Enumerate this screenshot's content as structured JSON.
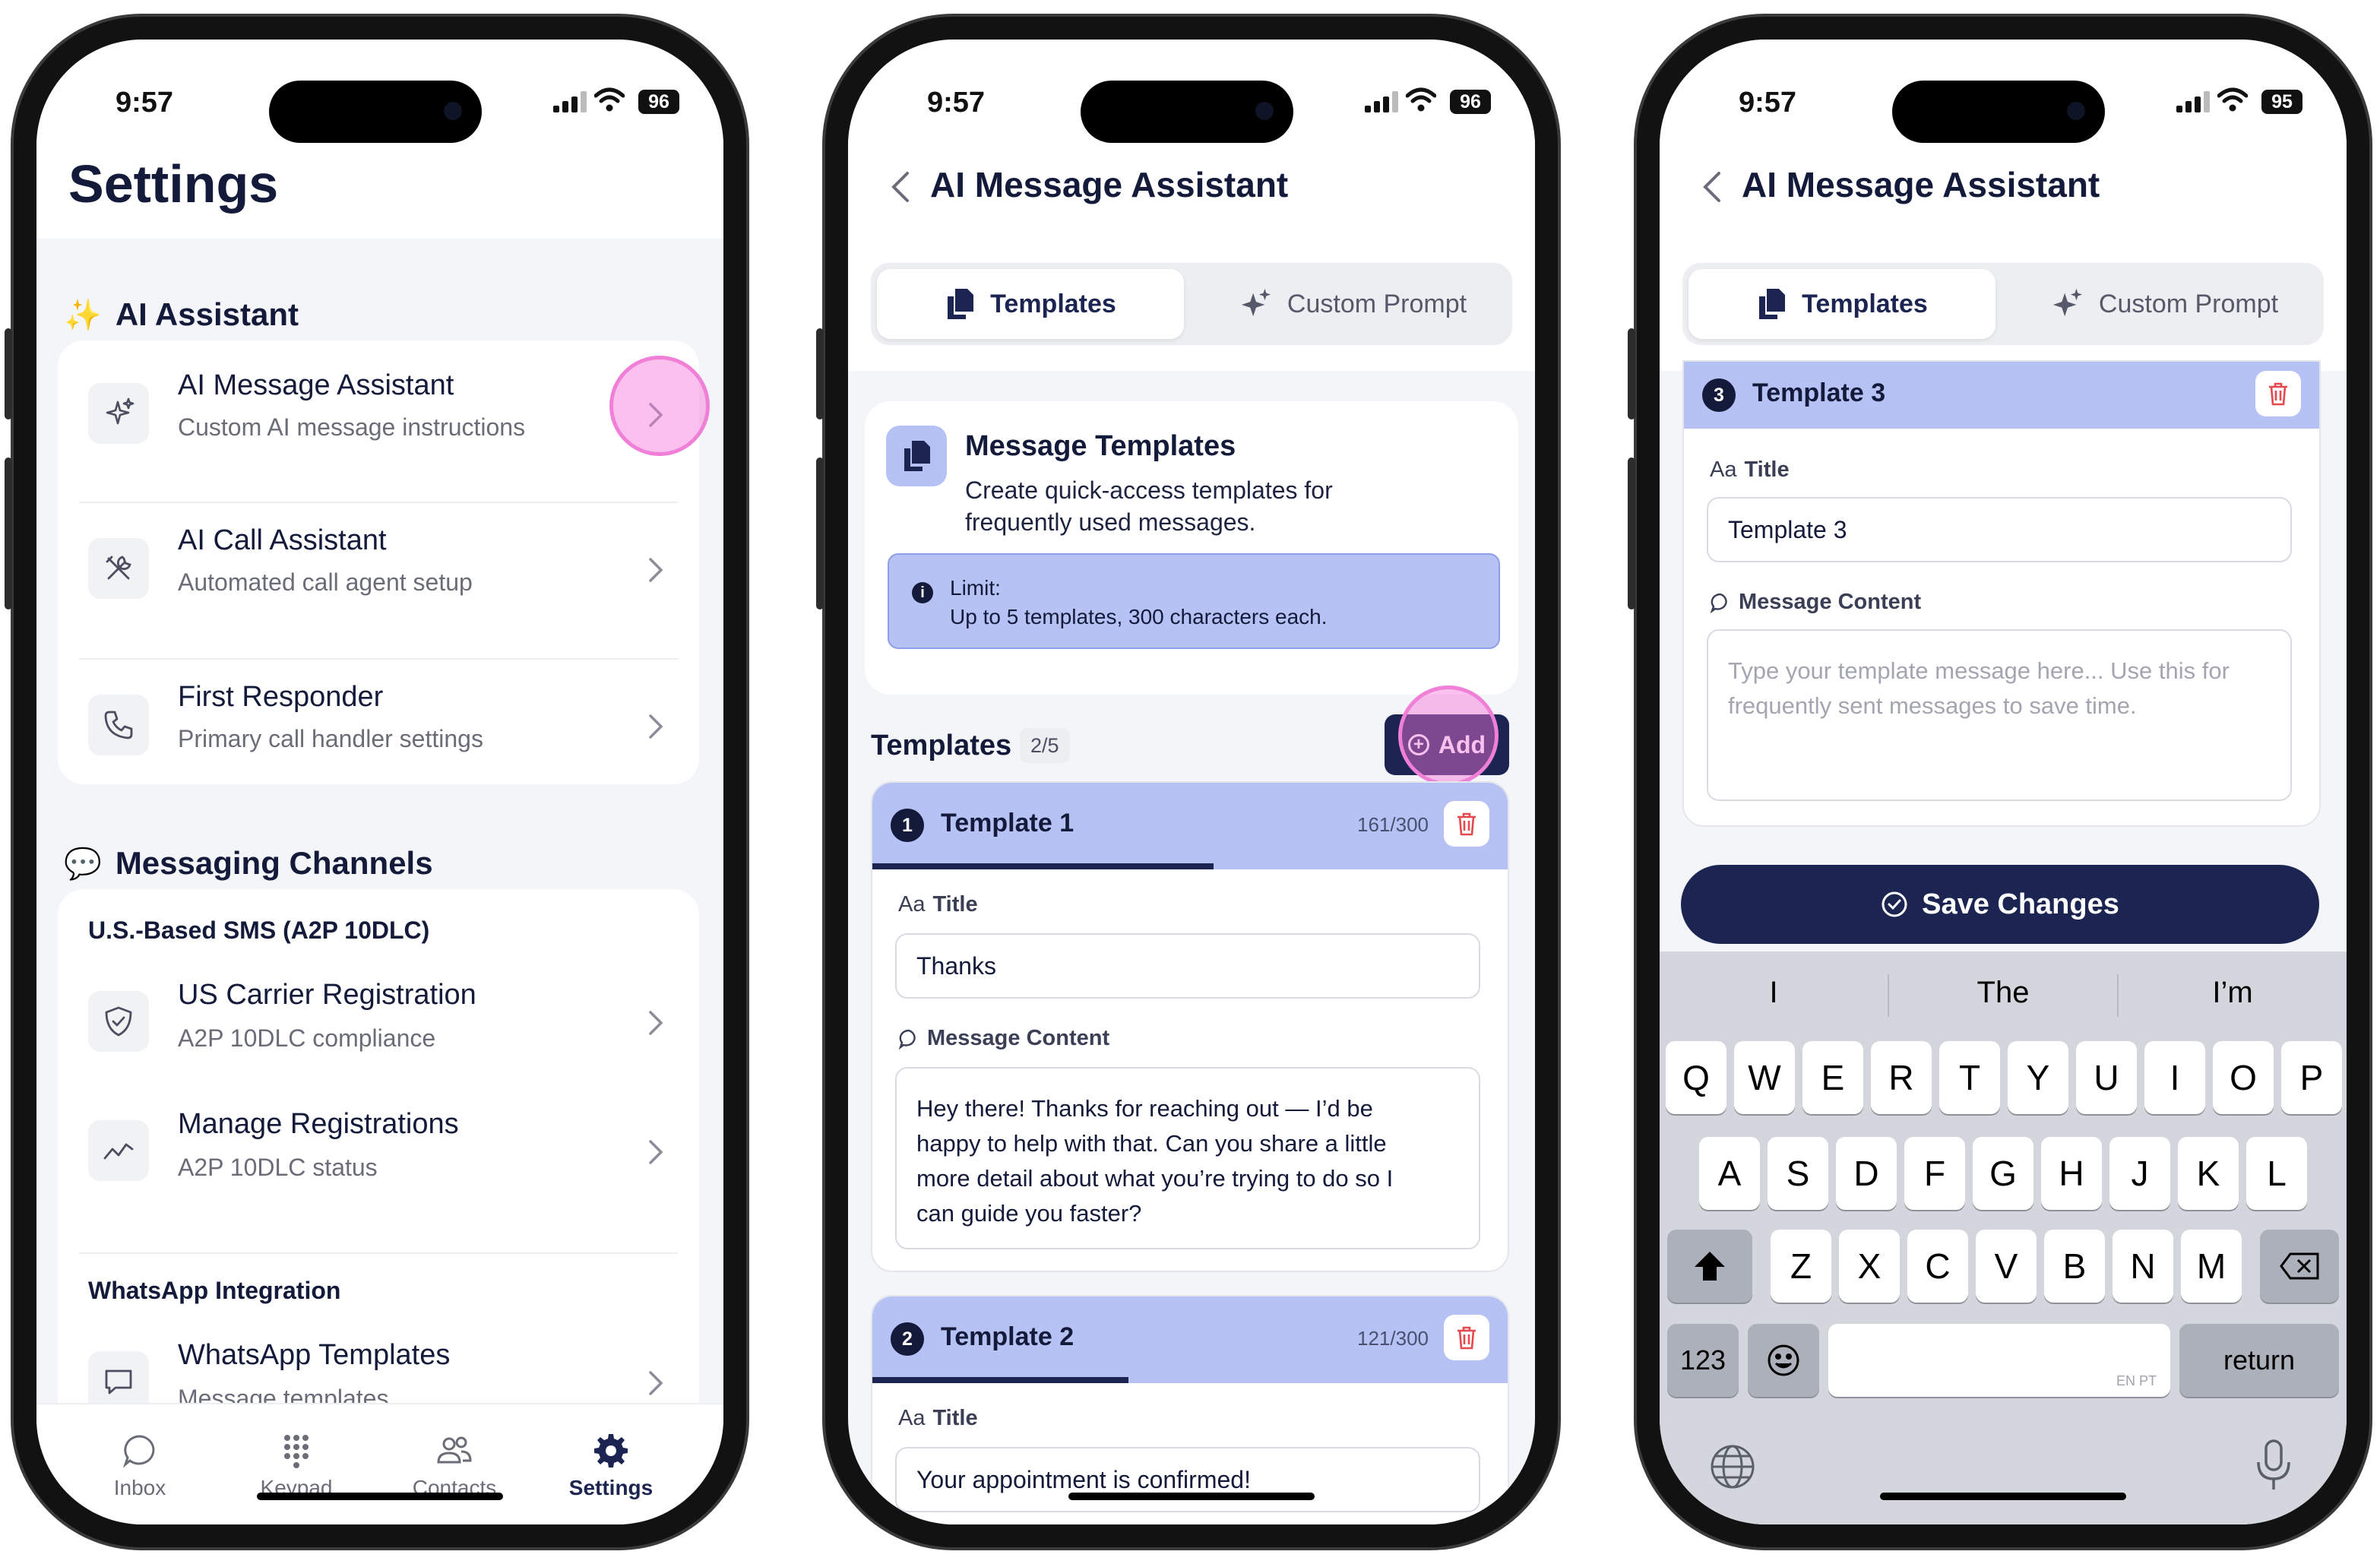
{
  "status": {
    "time": "9:57",
    "battery": [
      "96",
      "96",
      "95"
    ]
  },
  "settings": {
    "title": "Settings",
    "ai_section": "AI Assistant",
    "ai_items": [
      {
        "title": "AI Message Assistant",
        "subtitle": "Custom AI message instructions",
        "icon": "sparkles-icon"
      },
      {
        "title": "AI Call Assistant",
        "subtitle": "Automated call agent setup",
        "icon": "tools-icon"
      },
      {
        "title": "First Responder",
        "subtitle": "Primary call handler settings",
        "icon": "phone-icon"
      }
    ],
    "messaging_section": "Messaging Channels",
    "sms_header": "U.S.-Based SMS (A2P 10DLC)",
    "sms_items": [
      {
        "title": "US Carrier Registration",
        "subtitle": "A2P 10DLC compliance",
        "icon": "shield-check-icon"
      },
      {
        "title": "Manage Registrations",
        "subtitle": "A2P 10DLC status",
        "icon": "trend-icon"
      }
    ],
    "whatsapp_header": "WhatsApp Integration",
    "whatsapp_items": [
      {
        "title": "WhatsApp Templates",
        "subtitle": "Message templates",
        "icon": "chat-bubble-icon"
      }
    ],
    "tabs": [
      "Inbox",
      "Keypad",
      "Contacts",
      "Settings"
    ],
    "active_tab": "Settings"
  },
  "assistant": {
    "title": "AI Message Assistant",
    "segments": [
      "Templates",
      "Custom Prompt"
    ],
    "active_segment": "Templates",
    "intro_title": "Message Templates",
    "intro_desc_line1": "Create quick-access templates for",
    "intro_desc_line2": "frequently used messages.",
    "limit_label": "Limit:",
    "limit_text": "Up to 5 templates, 300 characters each.",
    "templates_header": "Templates",
    "templates_count": "2/5",
    "add_label": "Add",
    "title_label": "Title",
    "content_label": "Message Content",
    "templates": [
      {
        "num": "1",
        "name": "Template 1",
        "chars": "161/300",
        "progress": 0.537,
        "title_value": "Thanks",
        "content_lines": [
          "Hey there! Thanks for reaching out — I’d be",
          "happy to help with that. Can you share a little",
          "more detail about what you’re trying to do so I",
          "can guide you faster?"
        ]
      },
      {
        "num": "2",
        "name": "Template 2",
        "chars": "121/300",
        "progress": 0.403,
        "title_value": "Your appointment is confirmed!"
      }
    ]
  },
  "editor": {
    "title": "AI Message Assistant",
    "template_num": "3",
    "template_name": "Template 3",
    "title_label": "Title",
    "title_value": "Template 3",
    "content_label": "Message Content",
    "content_placeholder_line1": "Type your template message here... Use this for",
    "content_placeholder_line2": "frequently sent messages to save time.",
    "save_label": "Save Changes"
  },
  "keyboard": {
    "suggestions": [
      "I",
      "The",
      "I’m"
    ],
    "row1": [
      "Q",
      "W",
      "E",
      "R",
      "T",
      "Y",
      "U",
      "I",
      "O",
      "P"
    ],
    "row2": [
      "A",
      "S",
      "D",
      "F",
      "G",
      "H",
      "J",
      "K",
      "L"
    ],
    "row3": [
      "Z",
      "X",
      "C",
      "V",
      "B",
      "N",
      "M"
    ],
    "numbers_key": "123",
    "return_key": "return",
    "space_hint": "EN PT"
  },
  "colors": {
    "navy": "#1c2552",
    "lavender": "#b6c1f4",
    "highlight": "#f07fd8",
    "delete": "#e5484d"
  }
}
